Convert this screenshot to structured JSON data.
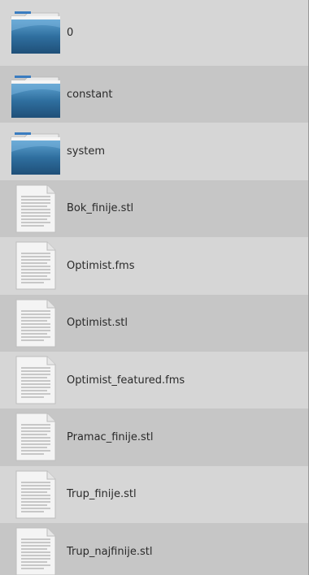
{
  "file_browser": {
    "items": [
      {
        "name": "0",
        "type": "folder"
      },
      {
        "name": "constant",
        "type": "folder"
      },
      {
        "name": "system",
        "type": "folder"
      },
      {
        "name": "Bok_finije.stl",
        "type": "file"
      },
      {
        "name": "Optimist.fms",
        "type": "file"
      },
      {
        "name": "Optimist.stl",
        "type": "file"
      },
      {
        "name": "Optimist_featured.fms",
        "type": "file"
      },
      {
        "name": "Pramac_finije.stl",
        "type": "file"
      },
      {
        "name": "Trup_finije.stl",
        "type": "file"
      },
      {
        "name": "Trup_najfinije.stl",
        "type": "file"
      }
    ],
    "icons": {
      "folder": "folder-icon",
      "file": "text-file-icon"
    },
    "colors": {
      "row_light": "#d6d6d6",
      "row_dark": "#c6c6c6",
      "folder_blue": "#2f6f9f"
    }
  }
}
